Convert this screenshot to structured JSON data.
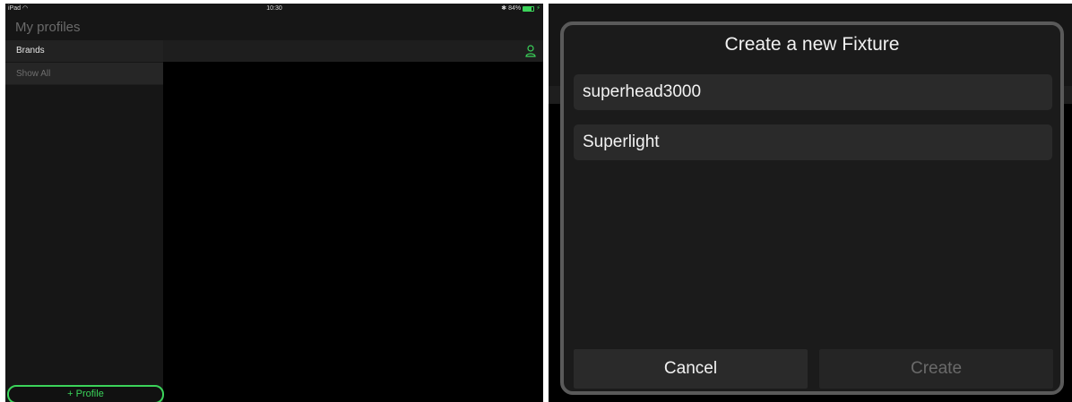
{
  "status_bar": {
    "device": "iPad",
    "time": "10:30",
    "battery_text": "84%",
    "battery_level": 0.84,
    "accent": "#3bd35a"
  },
  "app": {
    "title": "My profiles"
  },
  "sidebar": {
    "items": [
      {
        "label": "Brands"
      },
      {
        "label": "Show All"
      }
    ],
    "add_button_label": "+ Profile"
  },
  "header_icon": "user-icon",
  "dialog": {
    "title": "Create a new Fixture",
    "fields": [
      {
        "value": "superhead3000"
      },
      {
        "value": "Superlight"
      }
    ],
    "cancel_label": "Cancel",
    "create_label": "Create"
  }
}
